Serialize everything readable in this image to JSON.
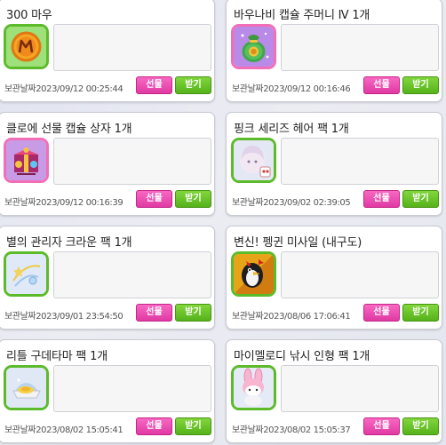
{
  "items": [
    {
      "title": "300 마우",
      "icon": "mau-coin-icon",
      "date_label": "보관날짜",
      "date": "2023/09/12 00:25:44",
      "gift_label": "선물",
      "receive_label": "받기"
    },
    {
      "title": "바우나비 캡슐 주머니 Ⅳ 1개",
      "icon": "capsule-pouch-icon",
      "date_label": "보관날짜",
      "date": "2023/09/12 00:16:46",
      "gift_label": "선물",
      "receive_label": "받기"
    },
    {
      "title": "클로에 선물 캡슐 상자 1개",
      "icon": "gift-capsule-box-icon",
      "date_label": "보관날짜",
      "date": "2023/09/12 00:16:39",
      "gift_label": "선물",
      "receive_label": "받기"
    },
    {
      "title": "핑크 세리즈 헤어 팩 1개",
      "icon": "pink-hair-pack-icon",
      "date_label": "보관날짜",
      "date": "2023/09/02 02:39:05",
      "gift_label": "선물",
      "receive_label": "받기"
    },
    {
      "title": "별의 관리자 크라운 팩 1개",
      "icon": "star-crown-pack-icon",
      "date_label": "보관날짜",
      "date": "2023/09/01 23:54:50",
      "gift_label": "선물",
      "receive_label": "받기"
    },
    {
      "title": "변신! 펭귄 미사일 (내구도)",
      "icon": "penguin-missile-icon",
      "date_label": "보관날짜",
      "date": "2023/08/06 17:06:41",
      "gift_label": "선물",
      "receive_label": "받기"
    },
    {
      "title": "리틀 구데타마 팩 1개",
      "icon": "little-gudetama-pack-icon",
      "date_label": "보관날짜",
      "date": "2023/08/02 15:05:41",
      "gift_label": "선물",
      "receive_label": "받기"
    },
    {
      "title": "마이멜로디 낚시 인형 팩 1개",
      "icon": "my-melody-fishing-doll-icon",
      "date_label": "보관날짜",
      "date": "2023/08/02 15:05:37",
      "gift_label": "선물",
      "receive_label": "받기"
    }
  ],
  "colors": {
    "gift_button": "#ee4fb5",
    "receive_button": "#62bf24",
    "icon_border_green": "#5cbb2b",
    "icon_border_pink": "#f26fb8"
  }
}
